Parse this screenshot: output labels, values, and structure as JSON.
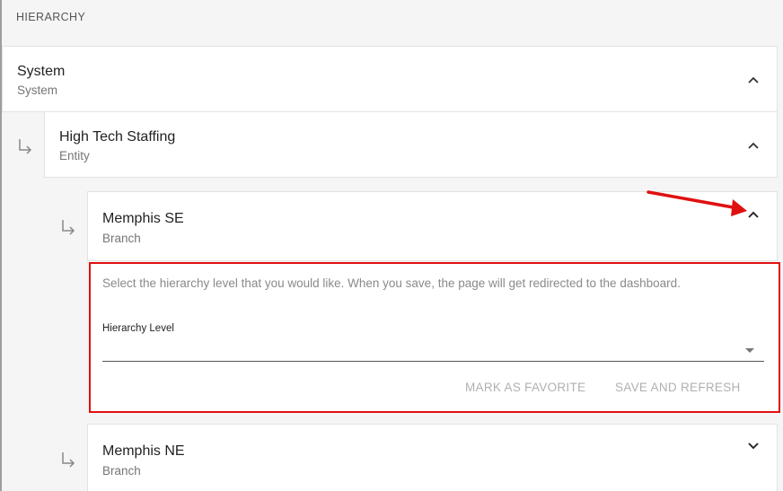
{
  "header": {
    "title": "HIERARCHY"
  },
  "levels": [
    {
      "title": "System",
      "subtitle": "System",
      "expanded": true
    },
    {
      "title": "High Tech Staffing",
      "subtitle": "Entity",
      "expanded": true
    },
    {
      "title": "Memphis SE",
      "subtitle": "Branch",
      "expanded": true
    },
    {
      "title": "Memphis NE",
      "subtitle": "Branch",
      "expanded": false
    }
  ],
  "panel": {
    "description": "Select the hierarchy level that you would like. When you save, the page will get redirected to the dashboard.",
    "field_label": "Hierarchy Level",
    "field_value": "",
    "favorite_label": "MARK AS FAVORITE",
    "save_label": "SAVE AND REFRESH"
  },
  "colors": {
    "highlight": "#e01010",
    "annotation_arrow": "#e01010",
    "disabled_text": "#b0b0b0"
  },
  "icons": {
    "child_indicator": "subdirectory-arrow-icon",
    "expand": "chevron-up-icon",
    "collapse": "chevron-down-icon"
  }
}
